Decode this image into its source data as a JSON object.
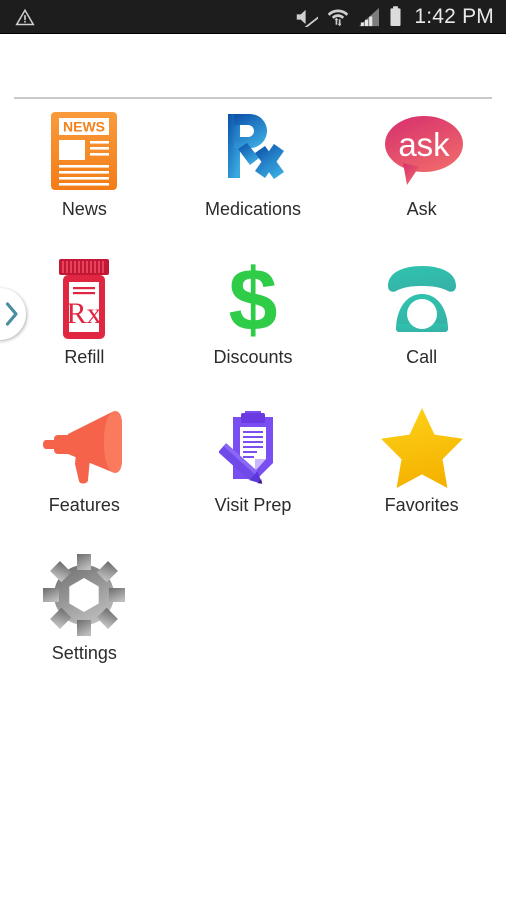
{
  "status_bar": {
    "background": "#1d1d1d",
    "time": "1:42 PM",
    "left_icons": [
      {
        "name": "warning-triangle-icon",
        "glyph": "warning"
      }
    ],
    "right_icons": [
      {
        "name": "mute-icon",
        "glyph": "sound-off"
      },
      {
        "name": "wifi-icon",
        "glyph": "wifi-data-transfer"
      },
      {
        "name": "cellular-signal-icon",
        "glyph": "signal-bars"
      },
      {
        "name": "battery-icon",
        "glyph": "battery-full"
      }
    ]
  },
  "drawer": {
    "handle_name": "drawer-open-handle",
    "chevron_direction": "right",
    "chevron_color": "#4a8fa0"
  },
  "grid": {
    "items": [
      {
        "label": "News",
        "icon": "news-icon",
        "color": "#f58220"
      },
      {
        "label": "Medications",
        "icon": "rx-symbol-icon",
        "color": "#1f74c8"
      },
      {
        "label": "Ask",
        "icon": "ask-bubble-icon",
        "color": "#e0436c"
      },
      {
        "label": "Refill",
        "icon": "pill-bottle-icon",
        "color": "#e02641"
      },
      {
        "label": "Discounts",
        "icon": "dollar-sign-icon",
        "color": "#2ecc47"
      },
      {
        "label": "Call",
        "icon": "telephone-icon",
        "color": "#29bfb0"
      },
      {
        "label": "Features",
        "icon": "megaphone-icon",
        "color": "#f4634a"
      },
      {
        "label": "Visit Prep",
        "icon": "clipboard-pencil-icon",
        "color": "#7a4ef0"
      },
      {
        "label": "Favorites",
        "icon": "star-icon",
        "color": "#f9c81c"
      },
      {
        "label": "Settings",
        "icon": "gear-icon",
        "color": "#8a8a8a"
      }
    ],
    "news_banner_text": "NEWS",
    "medications_symbol_text": "Rx",
    "ask_bubble_text": "ask",
    "refill_label_text": "Rx",
    "discounts_symbol_text": "$"
  },
  "page": {
    "background": "#ffffff",
    "label_color": "#2b2b2b",
    "divider_color": "#c9c9c9"
  }
}
